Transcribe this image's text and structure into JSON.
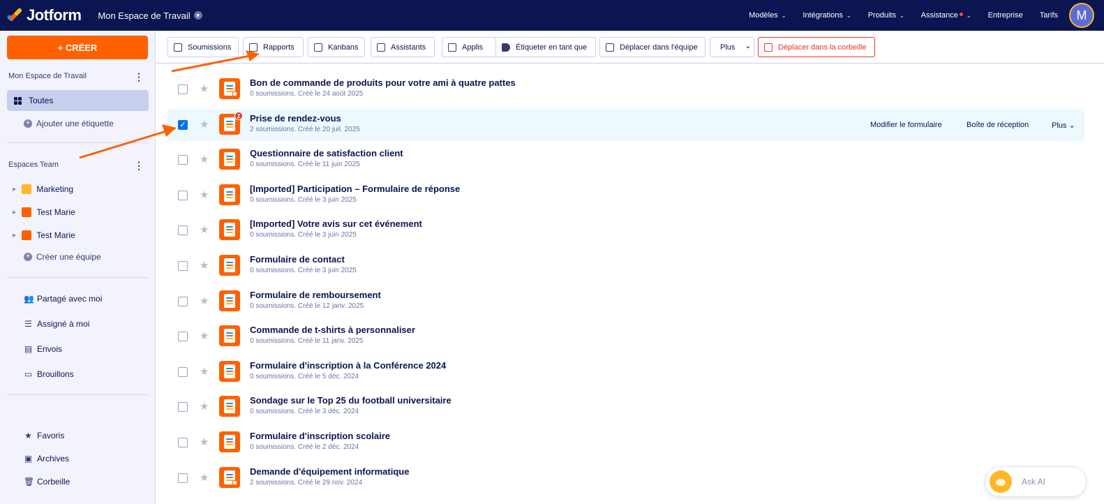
{
  "colors": {
    "nav_bg": "#0a1551",
    "accent": "#ff6100",
    "danger": "#e7322f",
    "selected_row": "#edf8ff",
    "checkbox": "#0075e3"
  },
  "topnav": {
    "logo": "Jotform",
    "workspace": "Mon Espace de Travail",
    "items": [
      {
        "label": "Modèles",
        "chevron": "⌄"
      },
      {
        "label": "Intégrations",
        "chevron": "⌄"
      },
      {
        "label": "Produits",
        "chevron": "⌄"
      },
      {
        "label": "Assistance",
        "chevron": "⌄"
      },
      {
        "label": "Entreprise",
        "chevron": ""
      },
      {
        "label": "Tarifs",
        "chevron": ""
      }
    ],
    "avatar": "M"
  },
  "sidebar": {
    "create_label": "+ CRÉER",
    "workspace_title": "Mon Espace de Travail",
    "all_label": "Toutes",
    "add_tag": "Ajouter une étiquette",
    "teams_title": "Espaces Team",
    "teams": [
      {
        "name": "Marketing",
        "color": "#ffb629"
      },
      {
        "name": "Test Marie",
        "color": "#ff6100"
      },
      {
        "name": "Test Marie",
        "color": "#ff6100"
      }
    ],
    "create_team": "Créer une équipe",
    "nav": [
      {
        "label": "Partagé avec moi",
        "icon": "users-icon",
        "glyph": "👥"
      },
      {
        "label": "Assigné à moi",
        "icon": "task-list-icon",
        "glyph": "☰"
      },
      {
        "label": "Envois",
        "icon": "message-icon",
        "glyph": "▤"
      },
      {
        "label": "Brouillons",
        "icon": "draft-icon",
        "glyph": "▭"
      }
    ],
    "nav2": [
      {
        "label": "Favoris",
        "icon": "star-icon",
        "glyph": "★"
      },
      {
        "label": "Archives",
        "icon": "archive-icon",
        "glyph": "▣"
      },
      {
        "label": "Corbeille",
        "icon": "trash-icon",
        "glyph": "🗑"
      }
    ]
  },
  "toolbar": {
    "buttons": [
      {
        "label": "Soumissions",
        "icon": "table-icon"
      },
      {
        "label": "Rapports",
        "icon": "report-icon"
      },
      {
        "label": "Kanbans",
        "icon": "kanban-icon"
      },
      {
        "label": "Assistants",
        "icon": "assistant-icon"
      },
      {
        "label": "Applis",
        "icon": "apps-icon"
      },
      {
        "label": "Étiqueter en tant que",
        "icon": "tag-icon"
      },
      {
        "label": "Déplacer dans l'équipe",
        "icon": "move-team-icon"
      },
      {
        "label": "Plus",
        "icon": "chevron-down-icon"
      },
      {
        "label": "Déplacer dans la corbeille",
        "icon": "trash-icon"
      }
    ]
  },
  "forms": [
    {
      "title": "Bon de commande de produits pour votre ami à quatre pattes",
      "subtitle": "0 soumissions. Créé le 24 août 2025",
      "checked": false,
      "badge": "",
      "edit": true
    },
    {
      "title": "Prise de rendez-vous",
      "subtitle": "2 soumissions. Créé le 20 juil. 2025",
      "checked": true,
      "badge": "2",
      "edit": false
    },
    {
      "title": "Questionnaire de satisfaction client",
      "subtitle": "0 soumissions. Créé le 11 juin 2025",
      "checked": false,
      "badge": "",
      "edit": false
    },
    {
      "title": "[Imported] Participation – Formulaire de réponse",
      "subtitle": "0 soumissions. Créé le 3 juin 2025",
      "checked": false,
      "badge": "",
      "edit": false
    },
    {
      "title": "[Imported] Votre avis sur cet événement",
      "subtitle": "0 soumissions. Créé le 3 juin 2025",
      "checked": false,
      "badge": "",
      "edit": false
    },
    {
      "title": "Formulaire de contact",
      "subtitle": "0 soumissions. Créé le 3 juin 2025",
      "checked": false,
      "badge": "",
      "edit": false
    },
    {
      "title": "Formulaire de remboursement",
      "subtitle": "0 soumissions. Créé le 12 janv. 2025",
      "checked": false,
      "badge": "",
      "edit": false
    },
    {
      "title": "Commande de t-shirts à personnaliser",
      "subtitle": "0 soumissions. Créé le 11 janv. 2025",
      "checked": false,
      "badge": "",
      "edit": false
    },
    {
      "title": "Formulaire d'inscription à la Conférence 2024",
      "subtitle": "0 soumissions. Créé le 5 déc. 2024",
      "checked": false,
      "badge": "",
      "edit": false
    },
    {
      "title": "Sondage sur le Top 25 du football universitaire",
      "subtitle": "0 soumissions. Créé le 3 déc. 2024",
      "checked": false,
      "badge": "",
      "edit": false
    },
    {
      "title": "Formulaire d'inscription scolaire",
      "subtitle": "0 soumissions. Créé le 2 déc. 2024",
      "checked": false,
      "badge": "",
      "edit": false
    },
    {
      "title": "Demande d'équipement informatique",
      "subtitle": "2 soumissions. Créé le 29 nov. 2024",
      "checked": false,
      "badge": "",
      "edit": true
    }
  ],
  "row_actions": {
    "edit": "Modifier le formulaire",
    "inbox": "Boîte de réception",
    "more": "Plus"
  },
  "ask_ai": "Ask AI"
}
